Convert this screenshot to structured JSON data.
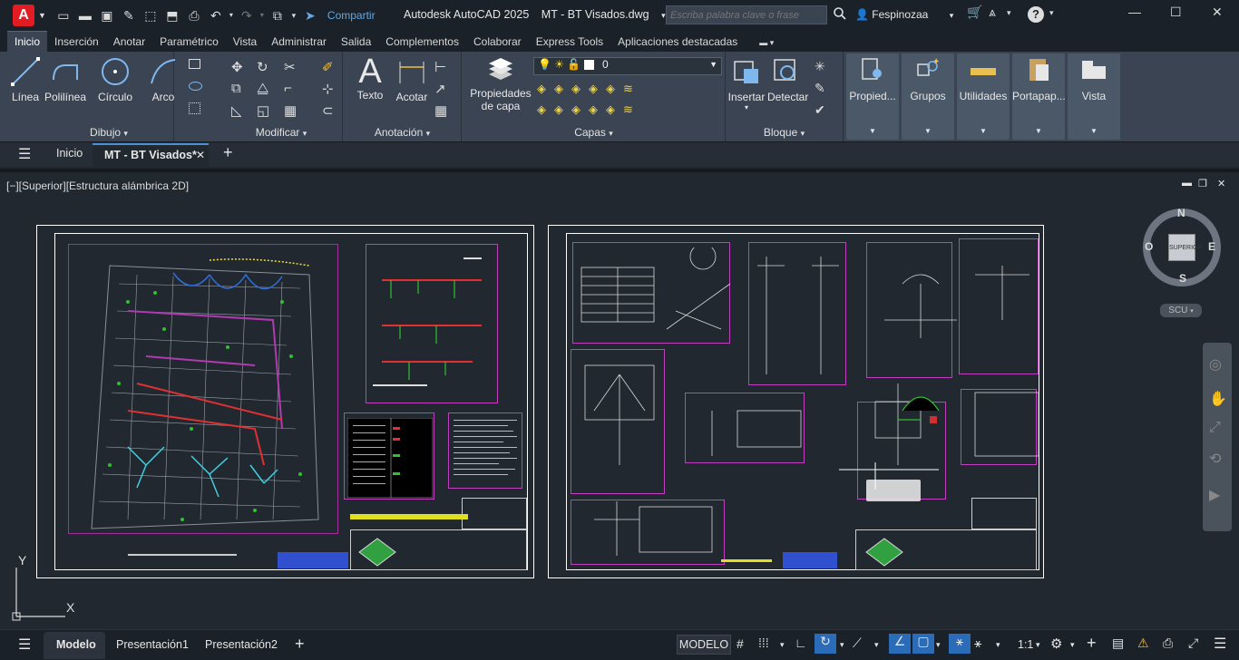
{
  "titlebar": {
    "app_logo": "A",
    "share_label": "Compartir",
    "app_name": "Autodesk AutoCAD 2025",
    "file_name": "MT - BT Visados.dwg",
    "search_placeholder": "Escriba palabra clave o frase",
    "user": "Fespinozaa"
  },
  "ribbon_tabs": [
    "Inicio",
    "Inserción",
    "Anotar",
    "Paramétrico",
    "Vista",
    "Administrar",
    "Salida",
    "Complementos",
    "Colaborar",
    "Express Tools",
    "Aplicaciones destacadas"
  ],
  "ribbon": {
    "draw": {
      "title": "Dibujo",
      "line": "Línea",
      "polyline": "Polilínea",
      "circle": "Círculo",
      "arc": "Arco"
    },
    "modify": {
      "title": "Modificar"
    },
    "annotation": {
      "title": "Anotación",
      "text": "Texto",
      "dimension": "Acotar"
    },
    "layers": {
      "title": "Capas",
      "properties_line1": "Propiedades",
      "properties_line2": "de capa",
      "current_layer": "0"
    },
    "block": {
      "title": "Bloque",
      "insert": "Insertar",
      "create": "Detectar"
    },
    "properties": "Propied...",
    "groups": "Grupos",
    "utilities": "Utilidades",
    "clipboard": "Portapap...",
    "view": "Vista"
  },
  "file_tabs": {
    "start": "Inicio",
    "active": "MT - BT Visados*"
  },
  "viewport": {
    "label": "[−][Superior][Estructura alámbrica 2D]",
    "viewcube": {
      "n": "N",
      "s": "S",
      "e": "E",
      "o": "O",
      "face": "SUPERIOR",
      "ucs": "SCU"
    },
    "ucs_y": "Y",
    "ucs_x": "X"
  },
  "status": {
    "tabs": [
      "Modelo",
      "Presentación1",
      "Presentación2"
    ],
    "mode": "MODELO",
    "scale": "1:1"
  }
}
